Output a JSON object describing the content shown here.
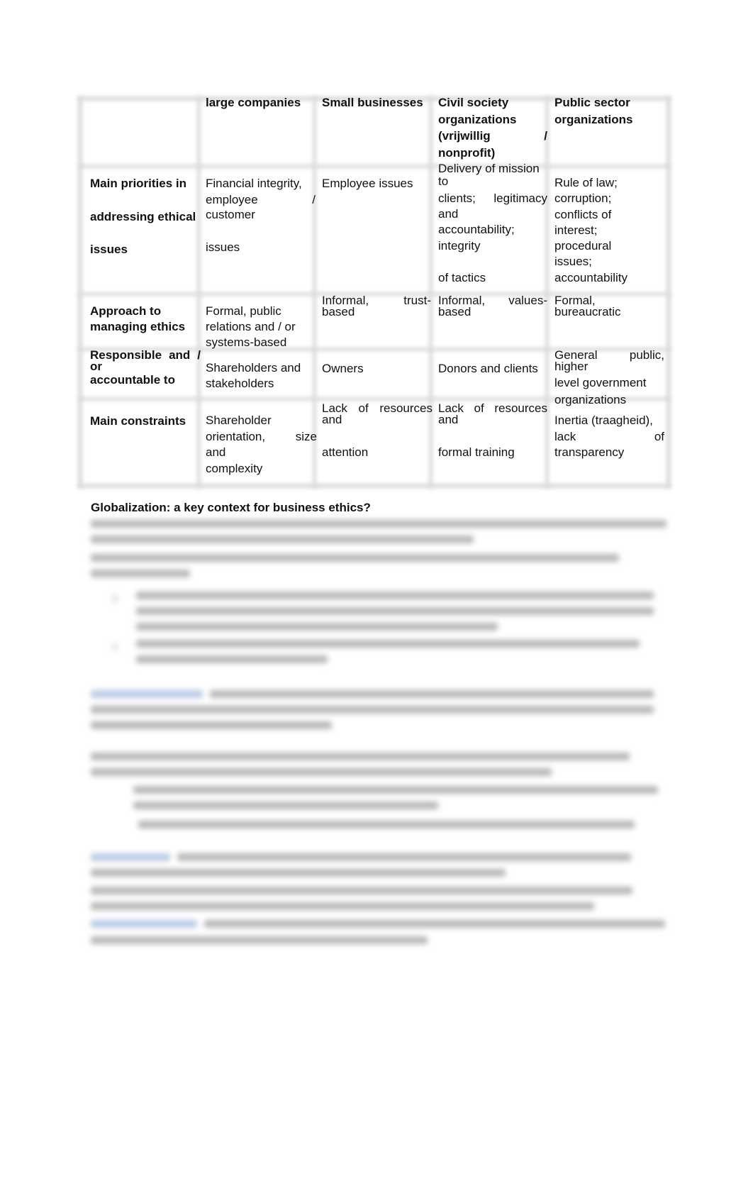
{
  "table": {
    "headers": [
      "",
      "large companies",
      "Small businesses",
      "Civil society organizations (vrijwillig / nonprofit)",
      "Public sector organizations"
    ],
    "header_lines": {
      "c1": [
        "large companies"
      ],
      "c2": [
        "Small businesses"
      ],
      "c3": [
        "Civil society",
        "organizations",
        "(vrijwillig",
        "/",
        "nonprofit)"
      ],
      "c4": [
        "Public sector",
        "organizations"
      ]
    },
    "rows": [
      {
        "label_lines": [
          "Main priorities in",
          "addressing ethical",
          "issues"
        ],
        "c1": [
          "Financial integrity,",
          "employee",
          "/",
          "customer",
          "issues"
        ],
        "c2": [
          "Employee issues"
        ],
        "c3": [
          "Delivery of mission",
          "to",
          "clients;",
          "legitimacy",
          "and",
          "accountability;",
          "integrity",
          "of tactics"
        ],
        "c4": [
          "Rule of law;",
          "corruption;",
          "conflicts of",
          "interest;",
          "procedural",
          "issues;",
          "accountability"
        ]
      },
      {
        "label_lines": [
          "Approach to",
          "managing ethics"
        ],
        "c1": [
          "Formal, public",
          "relations and / or",
          "systems-based"
        ],
        "c2": [
          "Informal,",
          "trust-",
          "based"
        ],
        "c3": [
          "Informal,",
          "values-",
          "based"
        ],
        "c4": [
          "Formal,",
          "bureaucratic"
        ]
      },
      {
        "label_lines": [
          "Responsible",
          "and",
          "/",
          "or",
          "accountable to"
        ],
        "c1": [
          "Shareholders and",
          "stakeholders"
        ],
        "c2": [
          "Owners"
        ],
        "c3": [
          "Donors and clients"
        ],
        "c4": [
          "General",
          "public,",
          "higher",
          "level government",
          "organizations"
        ]
      },
      {
        "label_lines": [
          "Main constraints"
        ],
        "c1": [
          "Shareholder",
          "orientation,",
          "size",
          "and",
          "complexity"
        ],
        "c2": [
          "Lack",
          "of",
          "resources",
          "and",
          "attention"
        ],
        "c3": [
          "Lack",
          "of",
          "resources",
          "and",
          "formal training"
        ],
        "c4": [
          "Inertia (traagheid),",
          "lack",
          "of",
          "transparency"
        ]
      }
    ]
  },
  "section": {
    "heading": "Globalization: a key context for business ethics?",
    "body_obscured": true
  }
}
